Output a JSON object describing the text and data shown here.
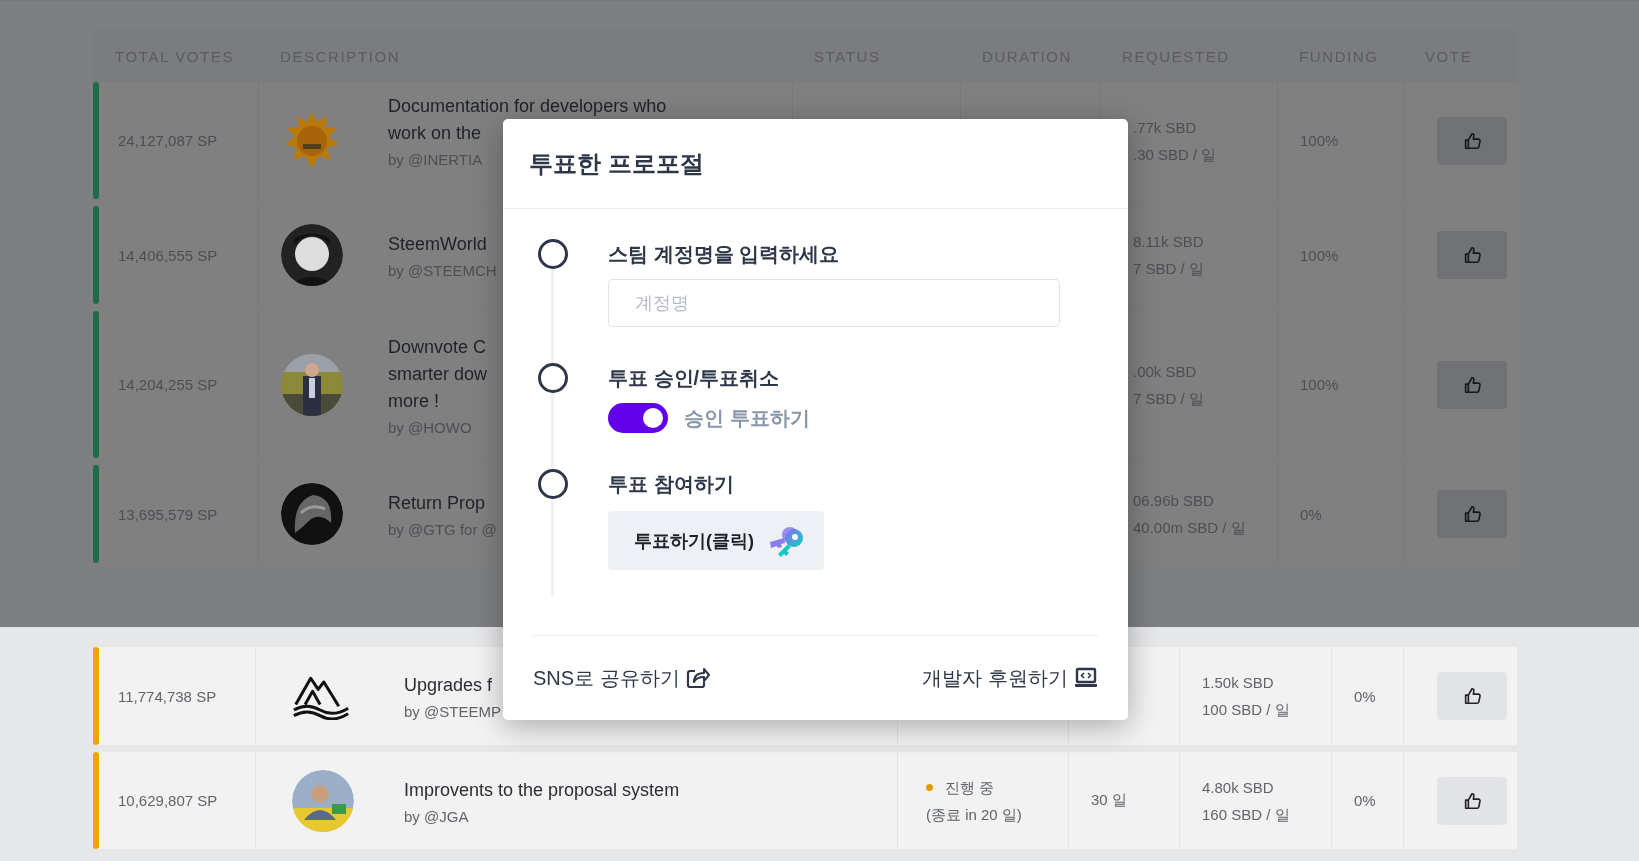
{
  "table": {
    "columns": [
      "TOTAL VOTES",
      "DESCRIPTION",
      "STATUS",
      "DURATION",
      "REQUESTED",
      "FUNDING",
      "VOTE"
    ],
    "groups": [
      {
        "color": "#1f6b4b",
        "rows": [
          {
            "total_votes": "24,127,087 SP",
            "avatar": {
              "kind": "picture"
            },
            "title_lines": [
              "Documentation for developers who",
              "work on the"
            ],
            "author": "by @INERTIA",
            "requested": [
              ".77k SBD",
              ".30 SBD / 일"
            ],
            "funding": "100%"
          },
          {
            "total_votes": "14,406,555 SP",
            "avatar": {
              "kind": "picture"
            },
            "title_lines": [
              "SteemWorld"
            ],
            "author": "by @STEEMCH",
            "requested": [
              "8.11k SBD",
              "7 SBD / 일"
            ],
            "funding": "100%"
          },
          {
            "total_votes": "14,204,255 SP",
            "avatar": {
              "kind": "picture"
            },
            "title_lines": [
              "Downvote C",
              "smarter dow",
              "more !"
            ],
            "author": "by @HOWO",
            "requested": [
              ".00k SBD",
              "7 SBD / 일"
            ],
            "funding": "100%"
          },
          {
            "total_votes": "13,695,579 SP",
            "avatar": {
              "kind": "picture"
            },
            "title_lines": [
              "Return Prop"
            ],
            "author": "by @GTG for @",
            "requested": [
              "06.96b SBD",
              "40.00m SBD / 일"
            ],
            "funding": "0%"
          }
        ]
      },
      {
        "color": "#f0a500",
        "rows": [
          {
            "total_votes": "11,774,738 SP",
            "avatar": {
              "kind": "logo"
            },
            "title_lines": [
              "Upgrades f"
            ],
            "author": "by @STEEMP",
            "requested": [
              "1.50k SBD",
              "100 SBD / 일"
            ],
            "funding": "0%"
          },
          {
            "total_votes": "10,629,807 SP",
            "avatar": {
              "kind": "picture"
            },
            "title_lines": [
              "Improvents to the proposal system"
            ],
            "author": "by @JGA",
            "status": {
              "color": "#e59c00",
              "label": "진행 중",
              "detail": "(종료 in 20 일)"
            },
            "duration": "30 일",
            "requested": [
              "4.80k SBD",
              "160 SBD / 일"
            ],
            "funding": "0%"
          }
        ]
      }
    ]
  },
  "modal": {
    "title": "투표한 프로포절",
    "steps": [
      {
        "kind": "input",
        "label": "스팀 계정명을 입력하세요",
        "placeholder": "계정명"
      },
      {
        "kind": "toggle",
        "label": "투표 승인/투표취소",
        "on": true,
        "toggle_label": "승인 투표하기"
      },
      {
        "kind": "button",
        "label": "투표 참여하기",
        "button": "투표하기(클릭)"
      }
    ],
    "footer": {
      "share": "SNS로 공유하기",
      "support": "개발자 후원하기"
    }
  }
}
